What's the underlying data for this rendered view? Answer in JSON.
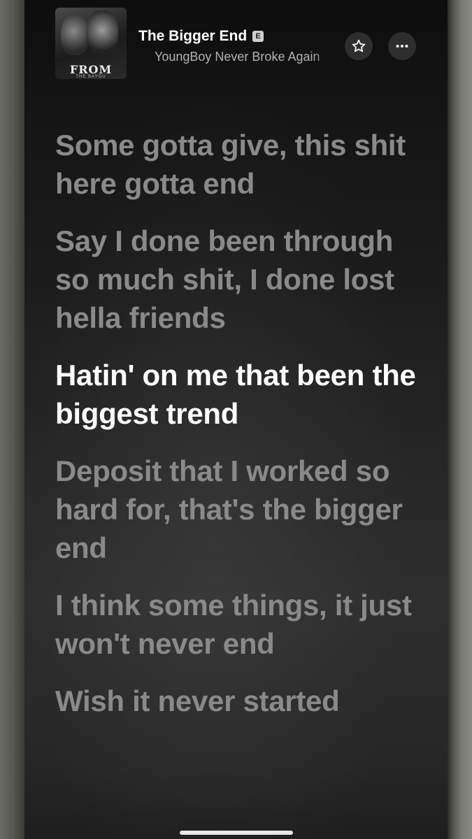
{
  "now_playing": {
    "title": "The Bigger End",
    "explicit_badge": "E",
    "artist": "YoungBoy Never Broke Again",
    "artwork": {
      "text": "FROM",
      "subtext": "THE BAYOU"
    },
    "favorite_icon": "star-outline-icon",
    "more_icon": "ellipsis-icon"
  },
  "lyrics": [
    {
      "text": "Some gotta give, this shit here gotta end",
      "active": false
    },
    {
      "text": "Say I done been through so much shit, I done lost hella friends",
      "active": false
    },
    {
      "text": "Hatin' on me that been the biggest trend",
      "active": true
    },
    {
      "text": "Deposit that I worked so hard for, that's the bigger end",
      "active": false
    },
    {
      "text": "I think some things, it just won't never end",
      "active": false
    },
    {
      "text": "Wish it never started",
      "active": false
    }
  ],
  "colors": {
    "active_lyric": "#ffffff",
    "inactive_lyric": "#8a8a8a",
    "background": "#1c1c1c"
  }
}
